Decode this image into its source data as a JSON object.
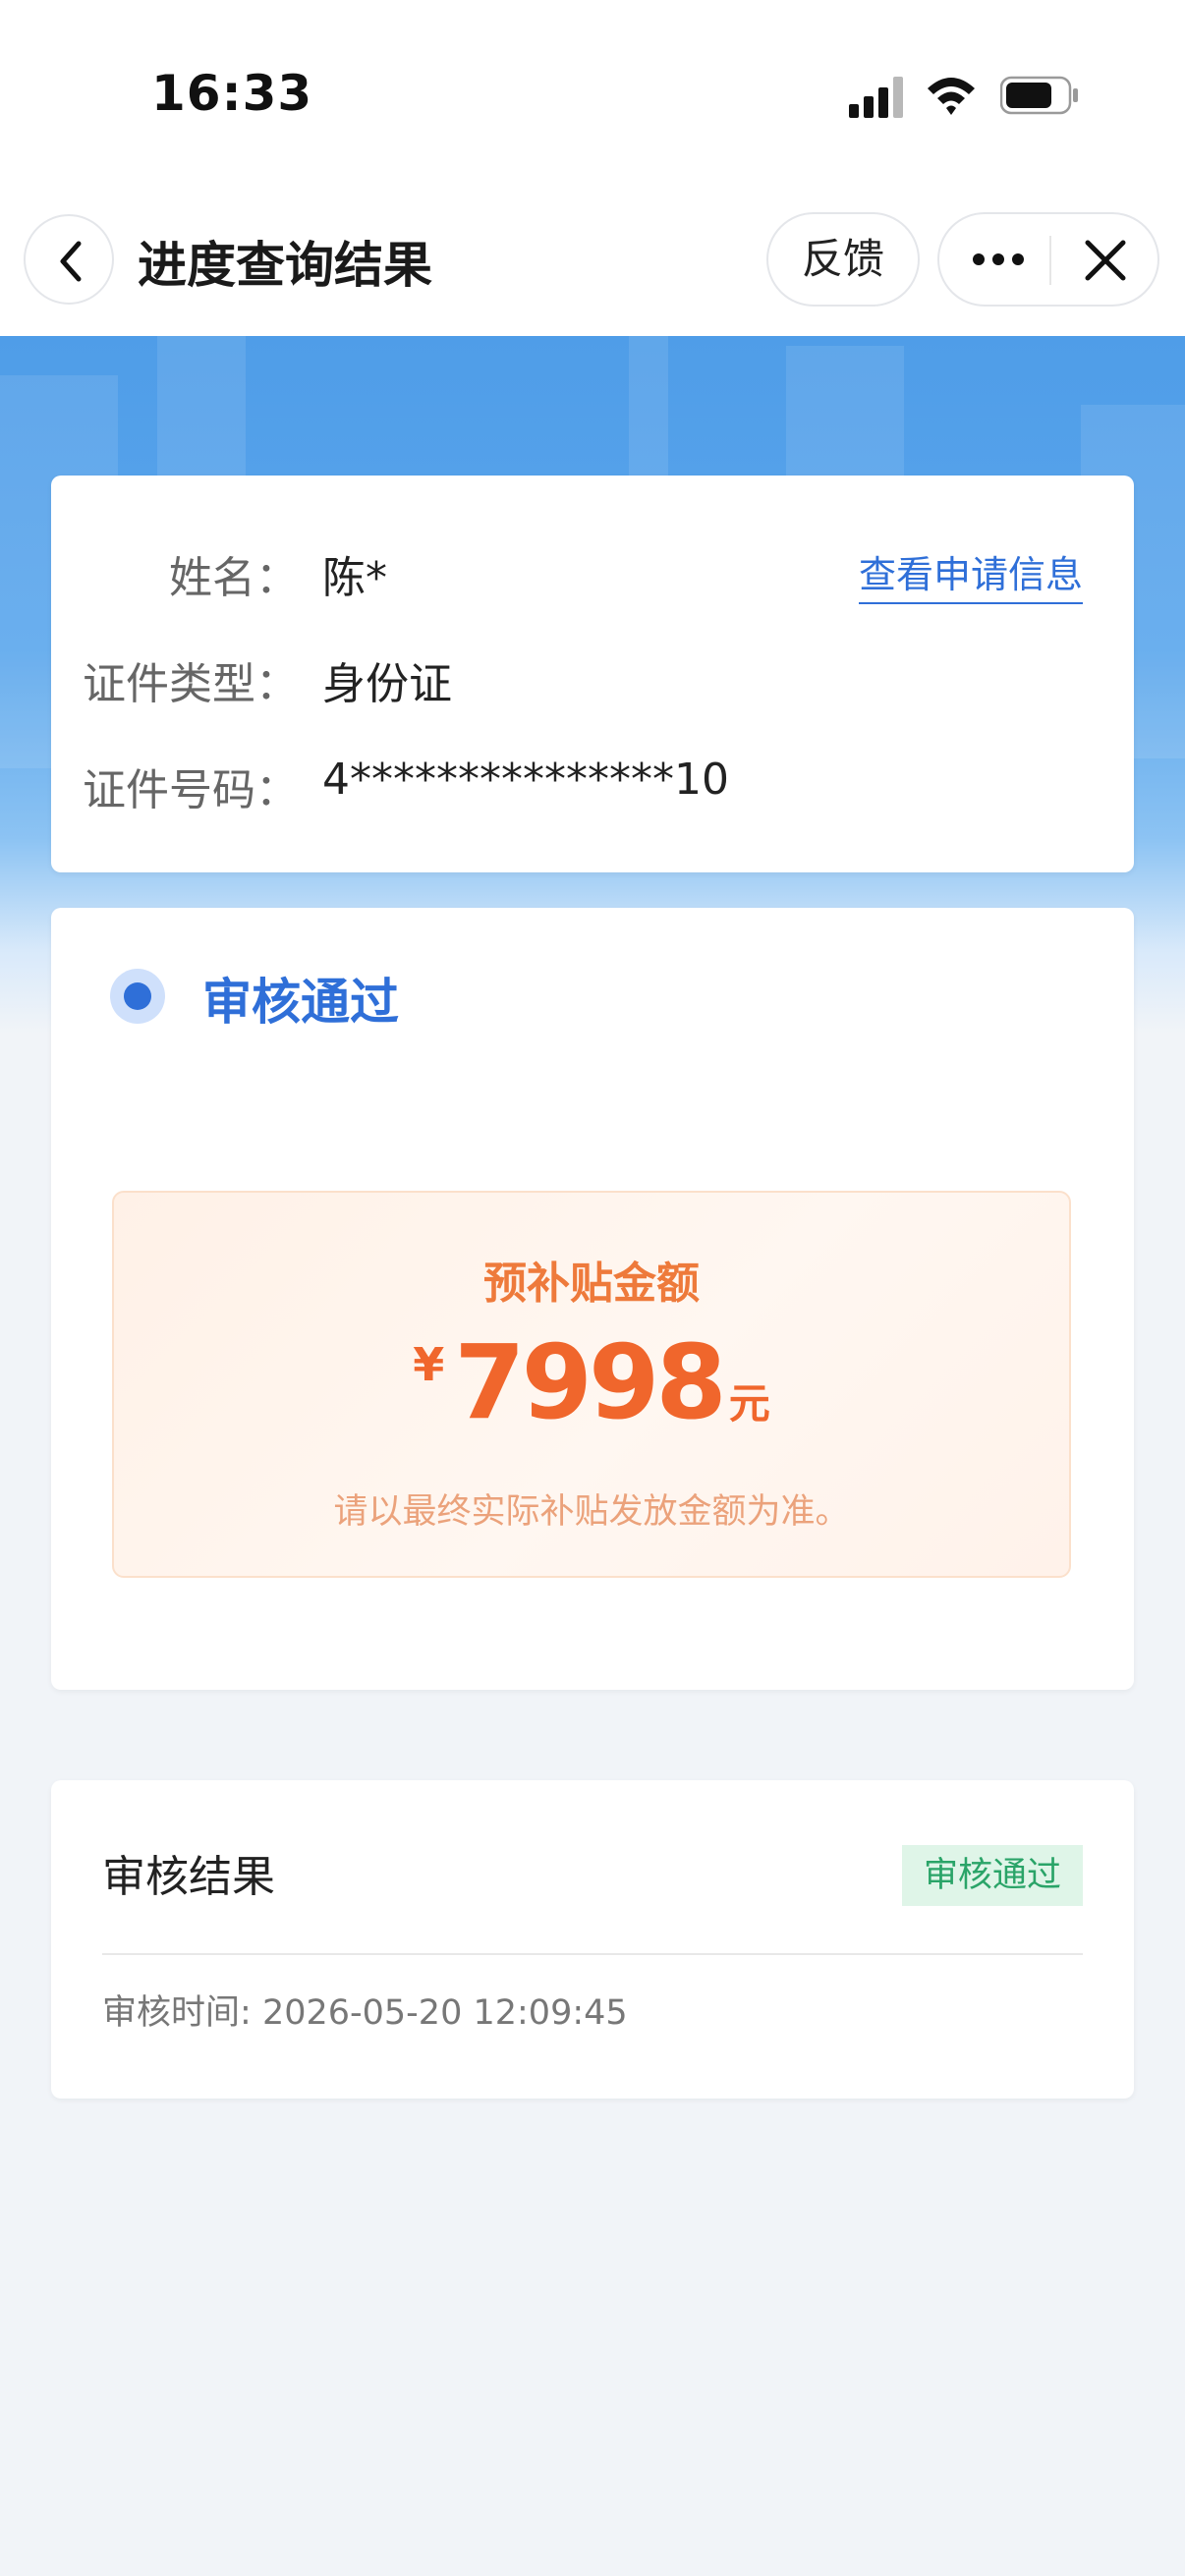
{
  "status_bar": {
    "time": "16:33"
  },
  "nav": {
    "title": "进度查询结果",
    "feedback_label": "反馈"
  },
  "applicant": {
    "name_label": "姓名：",
    "name_value": "陈*",
    "id_type_label": "证件类型：",
    "id_type_value": "身份证",
    "id_number_label": "证件号码：",
    "id_number_value": "4***************10",
    "view_link": "查看申请信息"
  },
  "status": {
    "label": "审核通过",
    "accent_color": "#2f6fd8"
  },
  "subsidy": {
    "title": "预补贴金额",
    "currency": "¥",
    "amount": "7998",
    "unit": "元",
    "note": "请以最终实际补贴发放金额为准。"
  },
  "review": {
    "label": "审核结果",
    "badge": "审核通过",
    "time_label": "审核时间:",
    "time_value": "2026-05-20 12:09:45"
  }
}
